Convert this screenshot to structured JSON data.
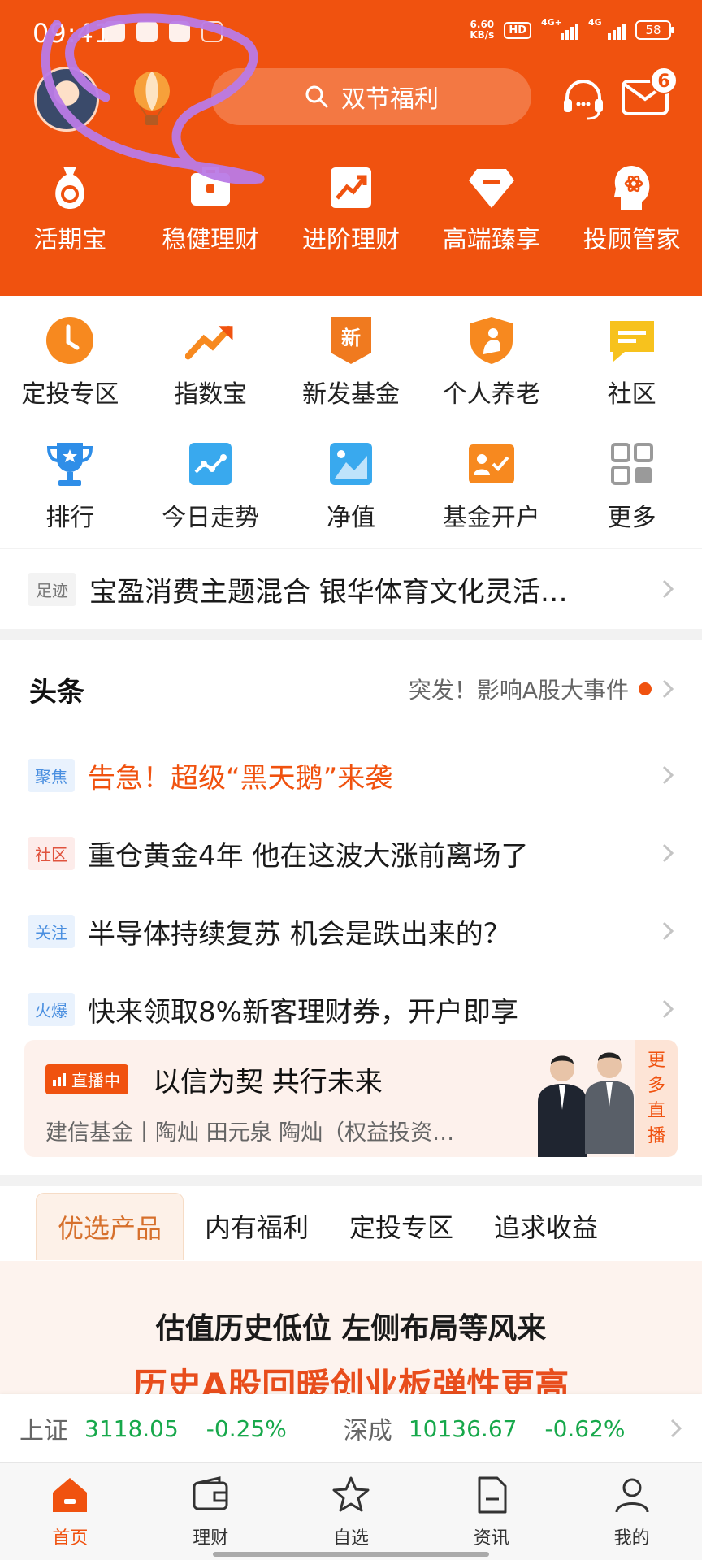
{
  "status_bar": {
    "time": "09:41",
    "net_speed_top": "6.60",
    "net_speed_bottom": "KB/s",
    "hd_label": "HD",
    "sim1": "4G+",
    "sim2": "4G",
    "battery": "58"
  },
  "header": {
    "search_placeholder": "双节福利",
    "mail_badge": "6",
    "tabs": [
      {
        "label": "活期宝",
        "icon": "money-bag-icon"
      },
      {
        "label": "稳健理财",
        "icon": "briefcase-icon"
      },
      {
        "label": "进阶理财",
        "icon": "trend-icon"
      },
      {
        "label": "高端臻享",
        "icon": "diamond-icon"
      },
      {
        "label": "投顾管家",
        "icon": "advisor-icon"
      }
    ]
  },
  "grid": {
    "row1": [
      {
        "label": "定投专区",
        "icon": "clock-icon"
      },
      {
        "label": "指数宝",
        "icon": "rising-arrow-icon"
      },
      {
        "label": "新发基金",
        "icon": "new-badge-icon",
        "badge_text": "新"
      },
      {
        "label": "个人养老",
        "icon": "pension-shield-icon"
      },
      {
        "label": "社区",
        "icon": "chat-icon"
      }
    ],
    "row2": [
      {
        "label": "排行",
        "icon": "trophy-icon"
      },
      {
        "label": "今日走势",
        "icon": "chart-icon"
      },
      {
        "label": "净值",
        "icon": "picture-chart-icon"
      },
      {
        "label": "基金开户",
        "icon": "account-card-icon"
      },
      {
        "label": "更多",
        "icon": "grid-more-icon"
      }
    ]
  },
  "footprint": {
    "tag": "足迹",
    "text": "宝盈消费主题混合 银华体育文化灵活…"
  },
  "news": {
    "title": "头条",
    "alert": "突发！影响A股大事件",
    "items": [
      {
        "tag": "聚焦",
        "tag_style": "blue",
        "text": "告急！超级“黑天鹅”来袭",
        "hot": true
      },
      {
        "tag": "社区",
        "tag_style": "red",
        "text": "重仓黄金4年 他在这波大涨前离场了",
        "hot": false
      },
      {
        "tag": "关注",
        "tag_style": "blue",
        "text": "半导体持续复苏 机会是跌出来的？",
        "hot": false
      },
      {
        "tag": "火爆",
        "tag_style": "blue",
        "text": "快来领取8%新客理财券，开户即享",
        "hot": false
      }
    ]
  },
  "live": {
    "badge": "直播中",
    "title": "以信为契  共行未来",
    "subtitle": "建信基金丨陶灿 田元泉 陶灿（权益投资…",
    "more": [
      "更",
      "多",
      "直",
      "播"
    ]
  },
  "product_tabs": [
    "优选产品",
    "内有福利",
    "定投专区",
    "追求收益"
  ],
  "promo": {
    "line1": "估值历史低位 左侧布局等风来",
    "line2": "历史A股回暖创业板弹性更高"
  },
  "ticker": [
    {
      "name": "上证",
      "value": "3118.05",
      "change": "-0.25%"
    },
    {
      "name": "深成",
      "value": "10136.67",
      "change": "-0.62%"
    }
  ],
  "bottom_nav": [
    {
      "label": "首页",
      "icon": "home-icon",
      "active": true
    },
    {
      "label": "理财",
      "icon": "wallet-icon",
      "active": false
    },
    {
      "label": "自选",
      "icon": "star-icon",
      "active": false
    },
    {
      "label": "资讯",
      "icon": "document-icon",
      "active": false
    },
    {
      "label": "我的",
      "icon": "user-icon",
      "active": false
    }
  ],
  "colors": {
    "brand_orange": "#f0520f",
    "down_green": "#17a84b",
    "scribble_purple": "#b97ae6"
  }
}
